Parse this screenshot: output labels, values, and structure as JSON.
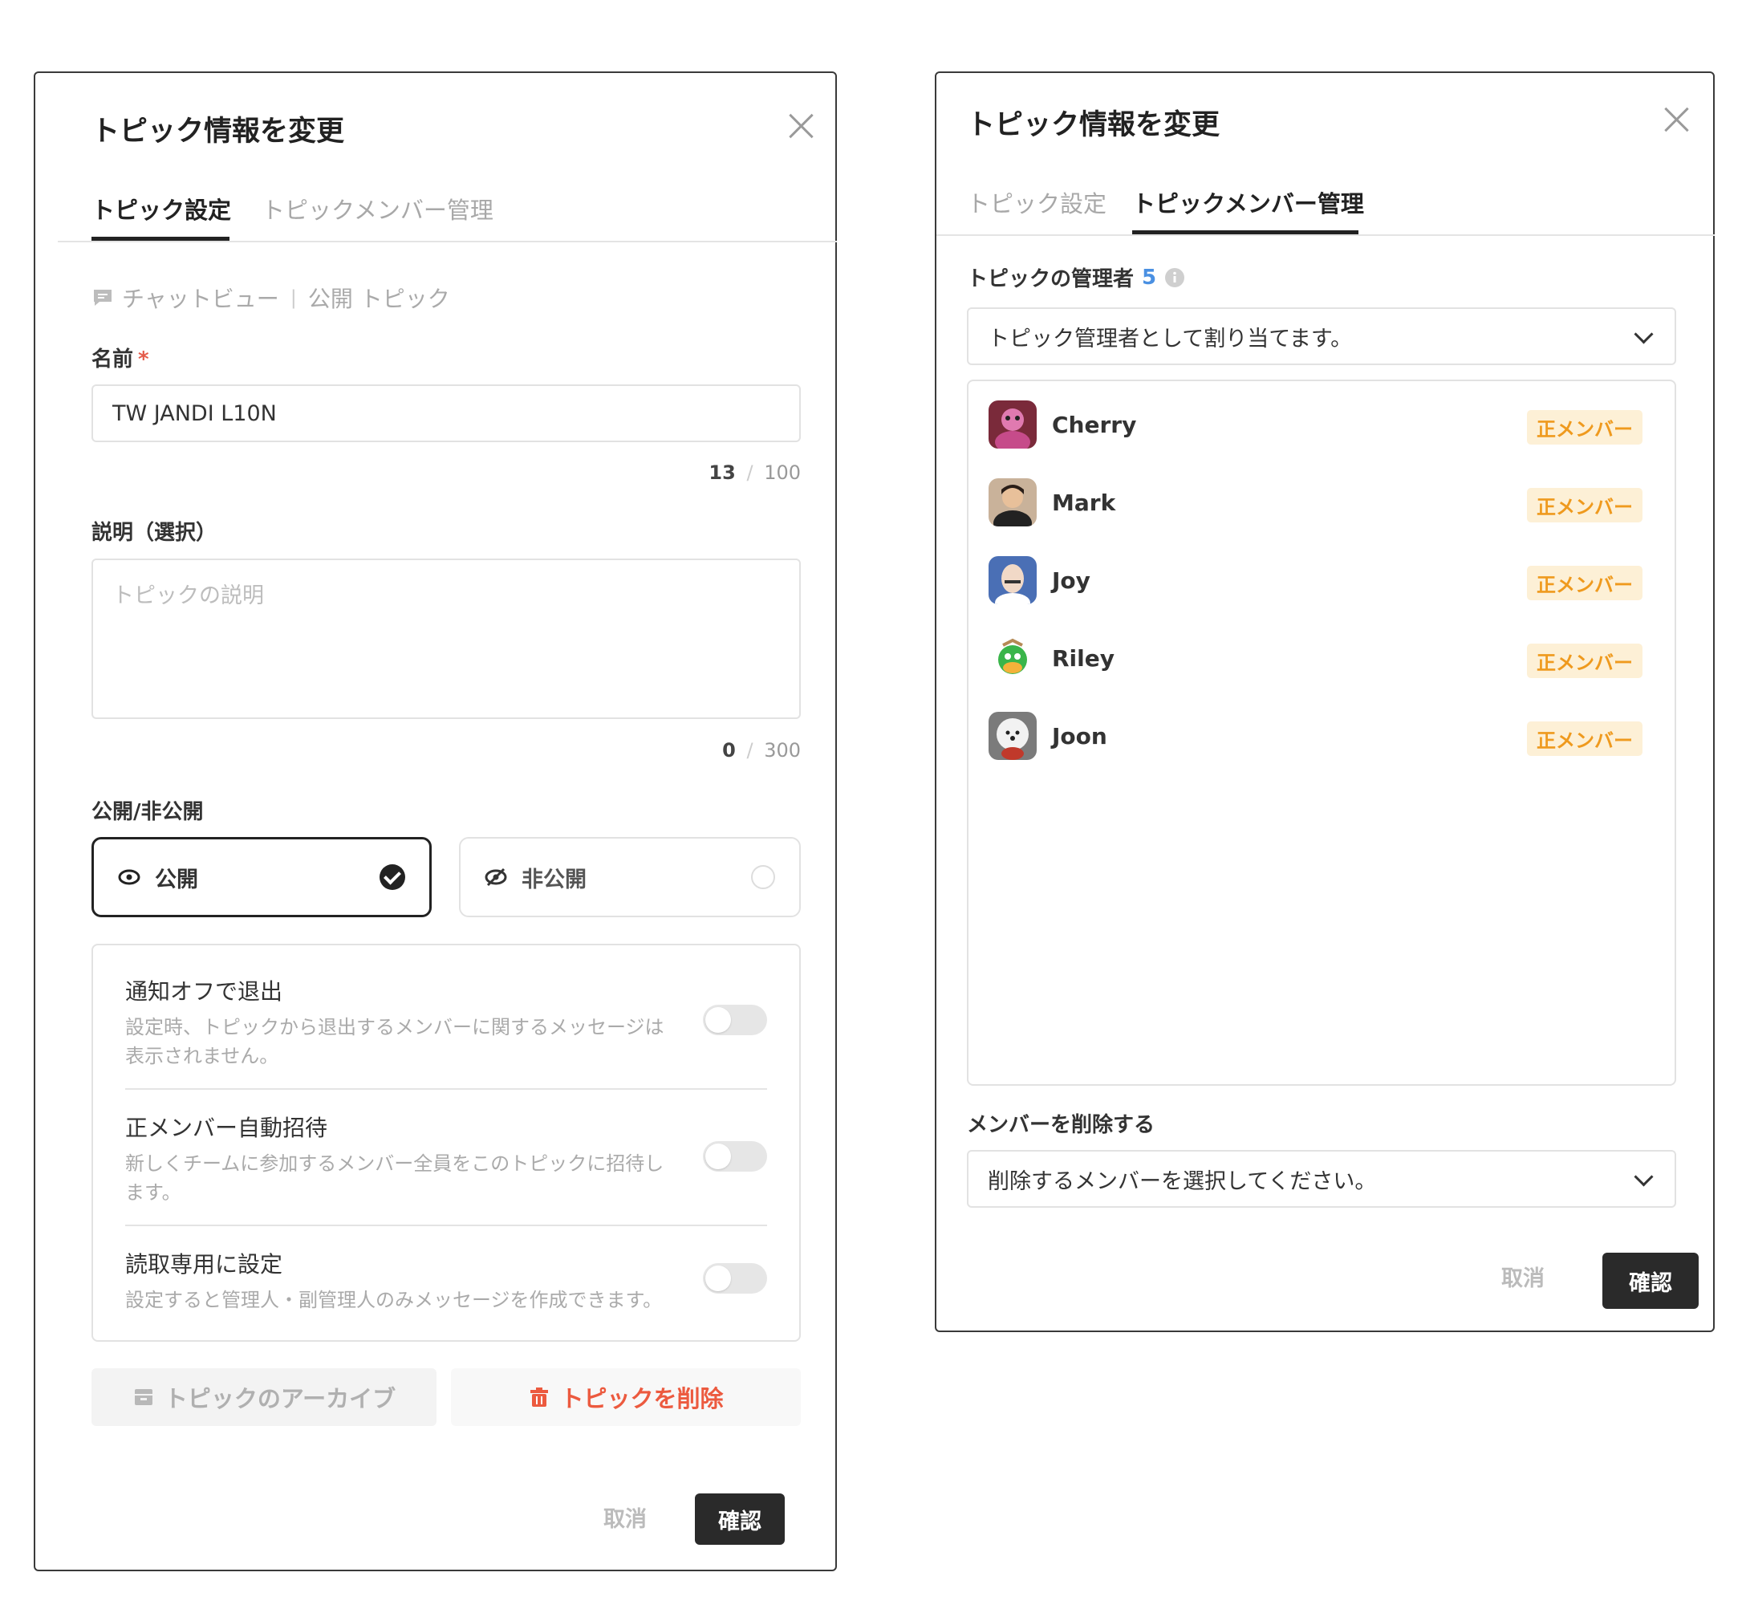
{
  "left_dialog": {
    "title": "トピック情報を変更",
    "tabs": [
      {
        "label": "トピック設定",
        "active": true
      },
      {
        "label": "トピックメンバー管理",
        "active": false
      }
    ],
    "breadcrumb": {
      "view": "チャットビュー",
      "separator": "|",
      "type": "公開 トピック"
    },
    "name_field": {
      "label": "名前",
      "required_mark": "*",
      "value": "TW JANDI L10N",
      "count": "13",
      "count_sep": "/",
      "max": "100"
    },
    "description_field": {
      "label": "説明（選択）",
      "placeholder": "トピックの説明",
      "count": "0",
      "count_sep": "/",
      "max": "300"
    },
    "visibility": {
      "label": "公開/非公開",
      "options": [
        {
          "label": "公開",
          "selected": true
        },
        {
          "label": "非公開",
          "selected": false
        }
      ]
    },
    "settings": [
      {
        "title": "通知オフで退出",
        "desc": "設定時、トピックから退出するメンバーに関するメッセージは表示されません。",
        "enabled": false
      },
      {
        "title": "正メンバー自動招待",
        "desc": "新しくチームに参加するメンバー全員をこのトピックに招待します。",
        "enabled": false
      },
      {
        "title": "読取専用に設定",
        "desc": "設定すると管理人・副管理人のみメッセージを作成できます。",
        "enabled": false
      }
    ],
    "archive_label": "トピックのアーカイブ",
    "delete_label": "トピックを削除",
    "cancel_label": "取消",
    "confirm_label": "確認"
  },
  "right_dialog": {
    "title": "トピック情報を変更",
    "tabs": [
      {
        "label": "トピック設定",
        "active": false
      },
      {
        "label": "トピックメンバー管理",
        "active": true
      }
    ],
    "admins_label": "トピックの管理者",
    "admins_count": "5",
    "assign_select": "トピック管理者として割り当てます。",
    "members": [
      {
        "name": "Cherry",
        "badge": "正メンバー"
      },
      {
        "name": "Mark",
        "badge": "正メンバー"
      },
      {
        "name": "Joy",
        "badge": "正メンバー"
      },
      {
        "name": "Riley",
        "badge": "正メンバー"
      },
      {
        "name": "Joon",
        "badge": "正メンバー"
      }
    ],
    "remove_label": "メンバーを削除する",
    "remove_select": "削除するメンバーを選択してください。",
    "cancel_label": "取消",
    "confirm_label": "確認"
  },
  "colors": {
    "accent_blue": "#4a90e2",
    "badge_text": "#ef9a1e",
    "badge_bg": "#fdf0d6",
    "danger": "#ec5a3f",
    "primary_button": "#2a2a2a"
  }
}
